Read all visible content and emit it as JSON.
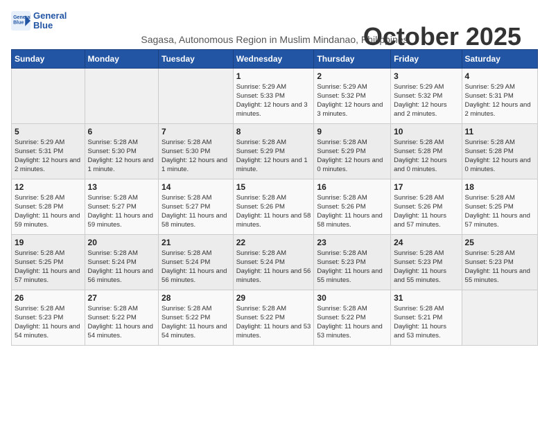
{
  "logo": {
    "line1": "General",
    "line2": "Blue"
  },
  "title": "October 2025",
  "subtitle": "Sagasa, Autonomous Region in Muslim Mindanao, Philippines",
  "days_of_week": [
    "Sunday",
    "Monday",
    "Tuesday",
    "Wednesday",
    "Thursday",
    "Friday",
    "Saturday"
  ],
  "weeks": [
    [
      {
        "day": "",
        "sunrise": "",
        "sunset": "",
        "daylight": ""
      },
      {
        "day": "",
        "sunrise": "",
        "sunset": "",
        "daylight": ""
      },
      {
        "day": "",
        "sunrise": "",
        "sunset": "",
        "daylight": ""
      },
      {
        "day": "1",
        "sunrise": "Sunrise: 5:29 AM",
        "sunset": "Sunset: 5:33 PM",
        "daylight": "Daylight: 12 hours and 3 minutes."
      },
      {
        "day": "2",
        "sunrise": "Sunrise: 5:29 AM",
        "sunset": "Sunset: 5:32 PM",
        "daylight": "Daylight: 12 hours and 3 minutes."
      },
      {
        "day": "3",
        "sunrise": "Sunrise: 5:29 AM",
        "sunset": "Sunset: 5:32 PM",
        "daylight": "Daylight: 12 hours and 2 minutes."
      },
      {
        "day": "4",
        "sunrise": "Sunrise: 5:29 AM",
        "sunset": "Sunset: 5:31 PM",
        "daylight": "Daylight: 12 hours and 2 minutes."
      }
    ],
    [
      {
        "day": "5",
        "sunrise": "Sunrise: 5:29 AM",
        "sunset": "Sunset: 5:31 PM",
        "daylight": "Daylight: 12 hours and 2 minutes."
      },
      {
        "day": "6",
        "sunrise": "Sunrise: 5:28 AM",
        "sunset": "Sunset: 5:30 PM",
        "daylight": "Daylight: 12 hours and 1 minute."
      },
      {
        "day": "7",
        "sunrise": "Sunrise: 5:28 AM",
        "sunset": "Sunset: 5:30 PM",
        "daylight": "Daylight: 12 hours and 1 minute."
      },
      {
        "day": "8",
        "sunrise": "Sunrise: 5:28 AM",
        "sunset": "Sunset: 5:29 PM",
        "daylight": "Daylight: 12 hours and 1 minute."
      },
      {
        "day": "9",
        "sunrise": "Sunrise: 5:28 AM",
        "sunset": "Sunset: 5:29 PM",
        "daylight": "Daylight: 12 hours and 0 minutes."
      },
      {
        "day": "10",
        "sunrise": "Sunrise: 5:28 AM",
        "sunset": "Sunset: 5:28 PM",
        "daylight": "Daylight: 12 hours and 0 minutes."
      },
      {
        "day": "11",
        "sunrise": "Sunrise: 5:28 AM",
        "sunset": "Sunset: 5:28 PM",
        "daylight": "Daylight: 12 hours and 0 minutes."
      }
    ],
    [
      {
        "day": "12",
        "sunrise": "Sunrise: 5:28 AM",
        "sunset": "Sunset: 5:28 PM",
        "daylight": "Daylight: 11 hours and 59 minutes."
      },
      {
        "day": "13",
        "sunrise": "Sunrise: 5:28 AM",
        "sunset": "Sunset: 5:27 PM",
        "daylight": "Daylight: 11 hours and 59 minutes."
      },
      {
        "day": "14",
        "sunrise": "Sunrise: 5:28 AM",
        "sunset": "Sunset: 5:27 PM",
        "daylight": "Daylight: 11 hours and 58 minutes."
      },
      {
        "day": "15",
        "sunrise": "Sunrise: 5:28 AM",
        "sunset": "Sunset: 5:26 PM",
        "daylight": "Daylight: 11 hours and 58 minutes."
      },
      {
        "day": "16",
        "sunrise": "Sunrise: 5:28 AM",
        "sunset": "Sunset: 5:26 PM",
        "daylight": "Daylight: 11 hours and 58 minutes."
      },
      {
        "day": "17",
        "sunrise": "Sunrise: 5:28 AM",
        "sunset": "Sunset: 5:26 PM",
        "daylight": "Daylight: 11 hours and 57 minutes."
      },
      {
        "day": "18",
        "sunrise": "Sunrise: 5:28 AM",
        "sunset": "Sunset: 5:25 PM",
        "daylight": "Daylight: 11 hours and 57 minutes."
      }
    ],
    [
      {
        "day": "19",
        "sunrise": "Sunrise: 5:28 AM",
        "sunset": "Sunset: 5:25 PM",
        "daylight": "Daylight: 11 hours and 57 minutes."
      },
      {
        "day": "20",
        "sunrise": "Sunrise: 5:28 AM",
        "sunset": "Sunset: 5:24 PM",
        "daylight": "Daylight: 11 hours and 56 minutes."
      },
      {
        "day": "21",
        "sunrise": "Sunrise: 5:28 AM",
        "sunset": "Sunset: 5:24 PM",
        "daylight": "Daylight: 11 hours and 56 minutes."
      },
      {
        "day": "22",
        "sunrise": "Sunrise: 5:28 AM",
        "sunset": "Sunset: 5:24 PM",
        "daylight": "Daylight: 11 hours and 56 minutes."
      },
      {
        "day": "23",
        "sunrise": "Sunrise: 5:28 AM",
        "sunset": "Sunset: 5:23 PM",
        "daylight": "Daylight: 11 hours and 55 minutes."
      },
      {
        "day": "24",
        "sunrise": "Sunrise: 5:28 AM",
        "sunset": "Sunset: 5:23 PM",
        "daylight": "Daylight: 11 hours and 55 minutes."
      },
      {
        "day": "25",
        "sunrise": "Sunrise: 5:28 AM",
        "sunset": "Sunset: 5:23 PM",
        "daylight": "Daylight: 11 hours and 55 minutes."
      }
    ],
    [
      {
        "day": "26",
        "sunrise": "Sunrise: 5:28 AM",
        "sunset": "Sunset: 5:23 PM",
        "daylight": "Daylight: 11 hours and 54 minutes."
      },
      {
        "day": "27",
        "sunrise": "Sunrise: 5:28 AM",
        "sunset": "Sunset: 5:22 PM",
        "daylight": "Daylight: 11 hours and 54 minutes."
      },
      {
        "day": "28",
        "sunrise": "Sunrise: 5:28 AM",
        "sunset": "Sunset: 5:22 PM",
        "daylight": "Daylight: 11 hours and 54 minutes."
      },
      {
        "day": "29",
        "sunrise": "Sunrise: 5:28 AM",
        "sunset": "Sunset: 5:22 PM",
        "daylight": "Daylight: 11 hours and 53 minutes."
      },
      {
        "day": "30",
        "sunrise": "Sunrise: 5:28 AM",
        "sunset": "Sunset: 5:22 PM",
        "daylight": "Daylight: 11 hours and 53 minutes."
      },
      {
        "day": "31",
        "sunrise": "Sunrise: 5:28 AM",
        "sunset": "Sunset: 5:21 PM",
        "daylight": "Daylight: 11 hours and 53 minutes."
      },
      {
        "day": "",
        "sunrise": "",
        "sunset": "",
        "daylight": ""
      }
    ]
  ]
}
